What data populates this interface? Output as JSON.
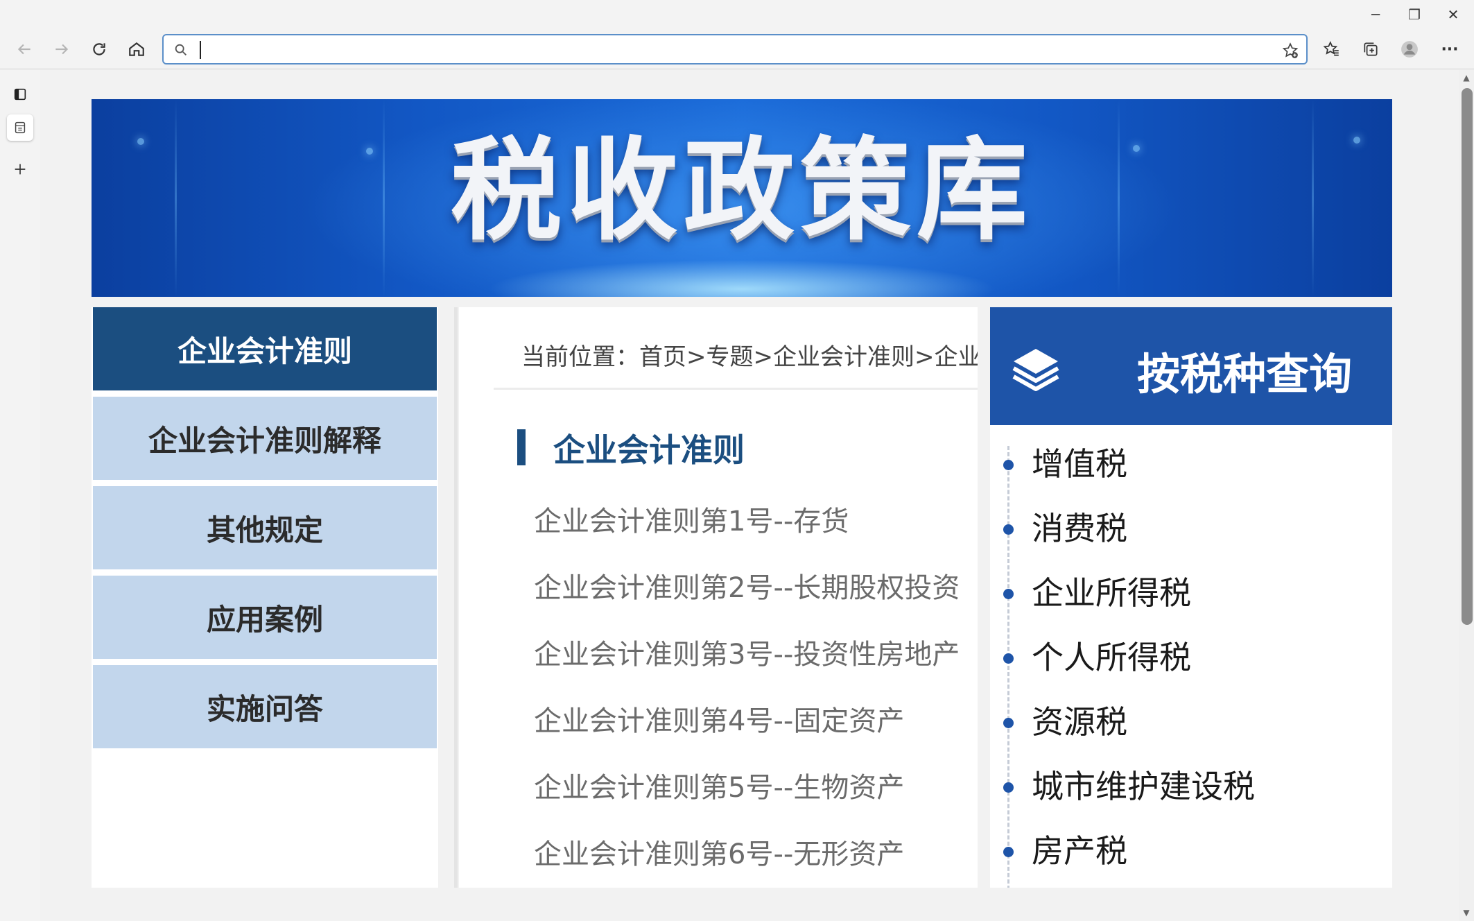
{
  "window": {
    "minimize_label": "─",
    "restore_label": "❐",
    "close_label": "✕"
  },
  "browser": {
    "address_value": "",
    "menu_label": "···"
  },
  "banner": {
    "title": "税收政策库"
  },
  "left_nav": {
    "items": [
      {
        "label": "企业会计准则",
        "active": true
      },
      {
        "label": "企业会计准则解释",
        "active": false
      },
      {
        "label": "其他规定",
        "active": false
      },
      {
        "label": "应用案例",
        "active": false
      },
      {
        "label": "实施问答",
        "active": false
      }
    ]
  },
  "center": {
    "breadcrumb": "当前位置：首页>专题>企业会计准则>企业会计准则",
    "section_title": "企业会计准则",
    "standards": [
      "企业会计准则第1号--存货",
      "企业会计准则第2号--长期股权投资",
      "企业会计准则第3号--投资性房地产",
      "企业会计准则第4号--固定资产",
      "企业会计准则第5号--生物资产",
      "企业会计准则第6号--无形资产"
    ]
  },
  "right_panel": {
    "title": "按税种查询",
    "taxes": [
      "增值税",
      "消费税",
      "企业所得税",
      "个人所得税",
      "资源税",
      "城市维护建设税",
      "房产税"
    ]
  },
  "colors": {
    "nav_active_bg": "#1b4e80",
    "nav_bg": "#c2d6ec",
    "header_blue": "#1e54a8",
    "address_border": "#5b8fc9"
  }
}
